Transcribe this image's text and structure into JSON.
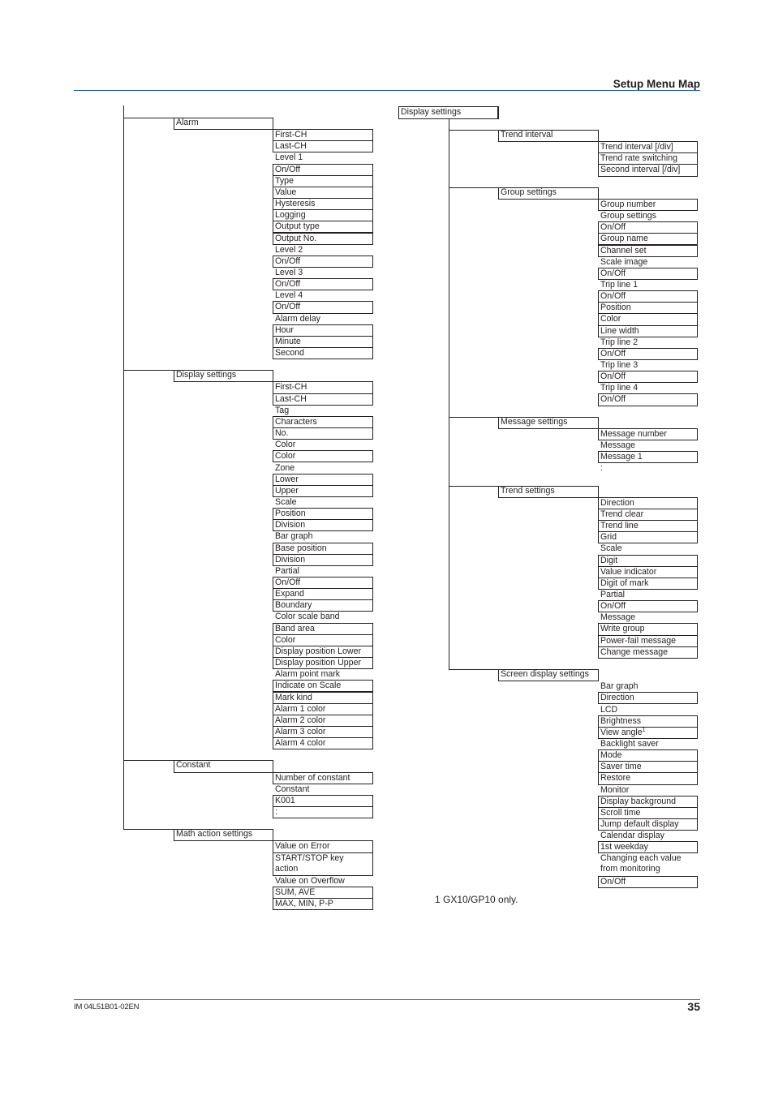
{
  "page": {
    "header_title": "Setup Menu Map",
    "footer_doc_id": "IM 04L51B01-02EN",
    "page_number": "35",
    "footnote": "1 GX10/GP10 only.",
    "rule_color": "#1f5aa6"
  },
  "left_tree": {
    "groups": [
      {
        "label": "Alarm",
        "items": [
          {
            "label": "First-CH",
            "boxed": true
          },
          {
            "label": "Last-CH",
            "boxed": true
          },
          {
            "label": "Level 1",
            "boxed": false
          },
          {
            "label": "On/Off",
            "boxed": true
          },
          {
            "label": "Type",
            "boxed": true
          },
          {
            "label": "Value",
            "boxed": true
          },
          {
            "label": "Hysteresis",
            "boxed": true
          },
          {
            "label": "Logging",
            "boxed": true
          },
          {
            "label": "Output type",
            "boxed": true
          },
          {
            "label": "Output No.",
            "boxed": true
          },
          {
            "label": "Level 2",
            "boxed": false
          },
          {
            "label": "On/Off",
            "boxed": true
          },
          {
            "label": "Level 3",
            "boxed": false
          },
          {
            "label": "On/Off",
            "boxed": true
          },
          {
            "label": "Level 4",
            "boxed": false
          },
          {
            "label": "On/Off",
            "boxed": true
          },
          {
            "label": "Alarm delay",
            "boxed": false
          },
          {
            "label": "Hour",
            "boxed": true
          },
          {
            "label": "Minute",
            "boxed": true
          },
          {
            "label": "Second",
            "boxed": true
          }
        ]
      },
      {
        "label": "Display settings",
        "items": [
          {
            "label": "First-CH",
            "boxed": true
          },
          {
            "label": "Last-CH",
            "boxed": true
          },
          {
            "label": "Tag",
            "boxed": false
          },
          {
            "label": "Characters",
            "boxed": true
          },
          {
            "label": "No.",
            "boxed": true
          },
          {
            "label": "Color",
            "boxed": false
          },
          {
            "label": "Color",
            "boxed": true
          },
          {
            "label": "Zone",
            "boxed": false
          },
          {
            "label": "Lower",
            "boxed": true
          },
          {
            "label": "Upper",
            "boxed": true
          },
          {
            "label": "Scale",
            "boxed": false
          },
          {
            "label": "Position",
            "boxed": true
          },
          {
            "label": "Division",
            "boxed": true
          },
          {
            "label": "Bar graph",
            "boxed": false
          },
          {
            "label": "Base position",
            "boxed": true
          },
          {
            "label": "Division",
            "boxed": true
          },
          {
            "label": "Partial",
            "boxed": false
          },
          {
            "label": "On/Off",
            "boxed": true
          },
          {
            "label": "Expand",
            "boxed": true
          },
          {
            "label": "Boundary",
            "boxed": true
          },
          {
            "label": "Color scale band",
            "boxed": false
          },
          {
            "label": "Band area",
            "boxed": true
          },
          {
            "label": "Color",
            "boxed": true
          },
          {
            "label": "Display position Lower",
            "boxed": true
          },
          {
            "label": "Display position Upper",
            "boxed": true
          },
          {
            "label": "Alarm point mark",
            "boxed": false
          },
          {
            "label": "Indicate on Scale",
            "boxed": true
          },
          {
            "label": "Mark kind",
            "boxed": true
          },
          {
            "label": "Alarm 1 color",
            "boxed": true
          },
          {
            "label": "Alarm 2 color",
            "boxed": true
          },
          {
            "label": "Alarm 3 color",
            "boxed": true
          },
          {
            "label": "Alarm 4 color",
            "boxed": true
          }
        ]
      },
      {
        "label": "Constant",
        "items": [
          {
            "label": "Number of constant",
            "boxed": true
          },
          {
            "label": "Constant",
            "boxed": false
          },
          {
            "label": "K001",
            "boxed": true
          },
          {
            "label": ":",
            "boxed": true
          }
        ]
      },
      {
        "label": "Math action settings",
        "items": [
          {
            "label": "Value on Error",
            "boxed": true
          },
          {
            "label": "START/STOP key",
            "label2": "action",
            "boxed": true
          },
          {
            "label": "Value on Overflow",
            "boxed": false
          },
          {
            "label": "SUM, AVE",
            "boxed": true
          },
          {
            "label": "MAX, MIN, P-P",
            "boxed": true
          }
        ]
      }
    ]
  },
  "right_tree": {
    "root_label": "Display settings",
    "groups": [
      {
        "label": "Trend interval",
        "items": [
          {
            "label": "Trend interval [/div]",
            "boxed": true
          },
          {
            "label": "Trend rate switching",
            "boxed": true
          },
          {
            "label": "Second interval [/div]",
            "boxed": true
          }
        ]
      },
      {
        "label": "Group settings",
        "items": [
          {
            "label": "Group number",
            "boxed": true
          },
          {
            "label": "Group settings",
            "boxed": false
          },
          {
            "label": "On/Off",
            "boxed": true
          },
          {
            "label": "Group name",
            "boxed": true
          },
          {
            "label": "Channel set",
            "boxed": true
          },
          {
            "label": "Scale image",
            "boxed": false
          },
          {
            "label": "On/Off",
            "boxed": true
          },
          {
            "label": "Trip line 1",
            "boxed": false
          },
          {
            "label": "On/Off",
            "boxed": true
          },
          {
            "label": "Position",
            "boxed": true
          },
          {
            "label": "Color",
            "boxed": true
          },
          {
            "label": "Line width",
            "boxed": true
          },
          {
            "label": "Trip line 2",
            "boxed": false
          },
          {
            "label": "On/Off",
            "boxed": true
          },
          {
            "label": "Trip line 3",
            "boxed": false
          },
          {
            "label": "On/Off",
            "boxed": true
          },
          {
            "label": "Trip line 4",
            "boxed": false
          },
          {
            "label": "On/Off",
            "boxed": true
          }
        ]
      },
      {
        "label": "Message settings",
        "items": [
          {
            "label": "Message number",
            "boxed": true
          },
          {
            "label": "Message",
            "boxed": false
          },
          {
            "label": "Message 1",
            "boxed": true
          },
          {
            "label": ":",
            "boxed": false
          }
        ]
      },
      {
        "label": "Trend settings",
        "items": [
          {
            "label": "Direction",
            "boxed": true
          },
          {
            "label": "Trend clear",
            "boxed": true
          },
          {
            "label": "Trend line",
            "boxed": true
          },
          {
            "label": "Grid",
            "boxed": true
          },
          {
            "label": "Scale",
            "boxed": false
          },
          {
            "label": "Digit",
            "boxed": true
          },
          {
            "label": "Value indicator",
            "boxed": true
          },
          {
            "label": "Digit of mark",
            "boxed": true
          },
          {
            "label": "Partial",
            "boxed": false
          },
          {
            "label": "On/Off",
            "boxed": true
          },
          {
            "label": "Message",
            "boxed": false
          },
          {
            "label": "Write group",
            "boxed": true
          },
          {
            "label": "Power-fail message",
            "boxed": true
          },
          {
            "label": "Change message",
            "boxed": true
          }
        ]
      },
      {
        "label": "Screen display settings",
        "items": [
          {
            "label": "Bar graph",
            "boxed": false
          },
          {
            "label": "Direction",
            "boxed": true
          },
          {
            "label": "LCD",
            "boxed": false
          },
          {
            "label": "Brightness",
            "boxed": true
          },
          {
            "label": "View angle",
            "sup": "1",
            "boxed": true
          },
          {
            "label": "Backlight saver",
            "boxed": false
          },
          {
            "label": "Mode",
            "boxed": true
          },
          {
            "label": "Saver time",
            "boxed": true
          },
          {
            "label": "Restore",
            "boxed": true
          },
          {
            "label": "Monitor",
            "boxed": false
          },
          {
            "label": "Display background",
            "boxed": true
          },
          {
            "label": "Scroll time",
            "boxed": true
          },
          {
            "label": "Jump default display",
            "boxed": true
          },
          {
            "label": "Calendar display",
            "boxed": false
          },
          {
            "label": "1st weekday",
            "boxed": true
          },
          {
            "label": "Changing each value",
            "label2": "from monitoring",
            "boxed": false
          },
          {
            "label": "On/Off",
            "boxed": true
          }
        ]
      }
    ]
  }
}
